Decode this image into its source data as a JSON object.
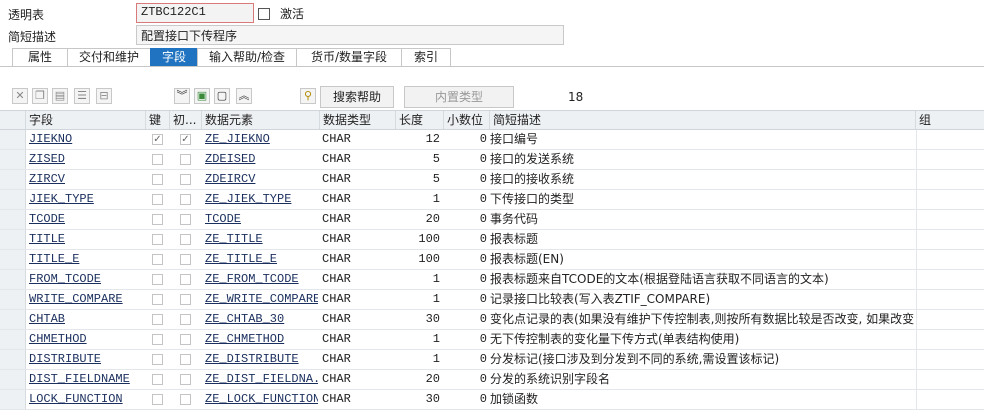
{
  "header": {
    "table_label": "透明表",
    "table_name": "ZTBC122C1",
    "status": "激活",
    "desc_label": "简短描述",
    "desc_value": "配置接口下传程序"
  },
  "tabs": [
    "属性",
    "交付和维护",
    "字段",
    "输入帮助/检查",
    "货币/数量字段",
    "索引"
  ],
  "active_tab": "字段",
  "toolbar": {
    "search_help": "搜索帮助",
    "builtin_type": "内置类型",
    "count": "18"
  },
  "columns": [
    "字段",
    "键",
    "初...",
    "数据元素",
    "数据类型",
    "长度",
    "小数位",
    "简短描述",
    "组"
  ],
  "rows": [
    {
      "field": "JIEKNO",
      "key": true,
      "init": true,
      "elem": "ZE_JIEKNO",
      "type": "CHAR",
      "len": "12",
      "dec": "0",
      "desc": "接口编号"
    },
    {
      "field": "ZISED",
      "key": false,
      "init": false,
      "elem": "ZDEISED",
      "type": "CHAR",
      "len": "5",
      "dec": "0",
      "desc": "接口的发送系统"
    },
    {
      "field": "ZIRCV",
      "key": false,
      "init": false,
      "elem": "ZDEIRCV",
      "type": "CHAR",
      "len": "5",
      "dec": "0",
      "desc": "接口的接收系统"
    },
    {
      "field": "JIEK_TYPE",
      "key": false,
      "init": false,
      "elem": "ZE_JIEK_TYPE",
      "type": "CHAR",
      "len": "1",
      "dec": "0",
      "desc": "下传接口的类型"
    },
    {
      "field": "TCODE",
      "key": false,
      "init": false,
      "elem": "TCODE",
      "type": "CHAR",
      "len": "20",
      "dec": "0",
      "desc": "事务代码"
    },
    {
      "field": "TITLE",
      "key": false,
      "init": false,
      "elem": "ZE_TITLE",
      "type": "CHAR",
      "len": "100",
      "dec": "0",
      "desc": "报表标题"
    },
    {
      "field": "TITLE_E",
      "key": false,
      "init": false,
      "elem": "ZE_TITLE_E",
      "type": "CHAR",
      "len": "100",
      "dec": "0",
      "desc": "报表标题(EN)"
    },
    {
      "field": "FROM_TCODE",
      "key": false,
      "init": false,
      "elem": "ZE_FROM_TCODE",
      "type": "CHAR",
      "len": "1",
      "dec": "0",
      "desc": "报表标题来自TCODE的文本(根据登陆语言获取不同语言的文本)"
    },
    {
      "field": "WRITE_COMPARE",
      "key": false,
      "init": false,
      "elem": "ZE_WRITE_COMPARE",
      "type": "CHAR",
      "len": "1",
      "dec": "0",
      "desc": "记录接口比较表(写入表ZTIF_COMPARE)"
    },
    {
      "field": "CHTAB",
      "key": false,
      "init": false,
      "elem": "ZE_CHTAB_30",
      "type": "CHAR",
      "len": "30",
      "dec": "0",
      "desc": "变化点记录的表(如果没有维护下传控制表,则按所有数据比较是否改变, 如果改变..."
    },
    {
      "field": "CHMETHOD",
      "key": false,
      "init": false,
      "elem": "ZE_CHMETHOD",
      "type": "CHAR",
      "len": "1",
      "dec": "0",
      "desc": "无下传控制表的变化量下传方式(单表结构使用)"
    },
    {
      "field": "DISTRIBUTE",
      "key": false,
      "init": false,
      "elem": "ZE_DISTRIBUTE",
      "type": "CHAR",
      "len": "1",
      "dec": "0",
      "desc": "分发标记(接口涉及到分发到不同的系统,需设置该标记)"
    },
    {
      "field": "DIST_FIELDNAME",
      "key": false,
      "init": false,
      "elem": "ZE_DIST_FIELDNA...",
      "type": "CHAR",
      "len": "20",
      "dec": "0",
      "desc": "分发的系统识别字段名"
    },
    {
      "field": "LOCK_FUNCTION",
      "key": false,
      "init": false,
      "elem": "ZE_LOCK_FUNCTION",
      "type": "CHAR",
      "len": "30",
      "dec": "0",
      "desc": "加锁函数"
    }
  ]
}
